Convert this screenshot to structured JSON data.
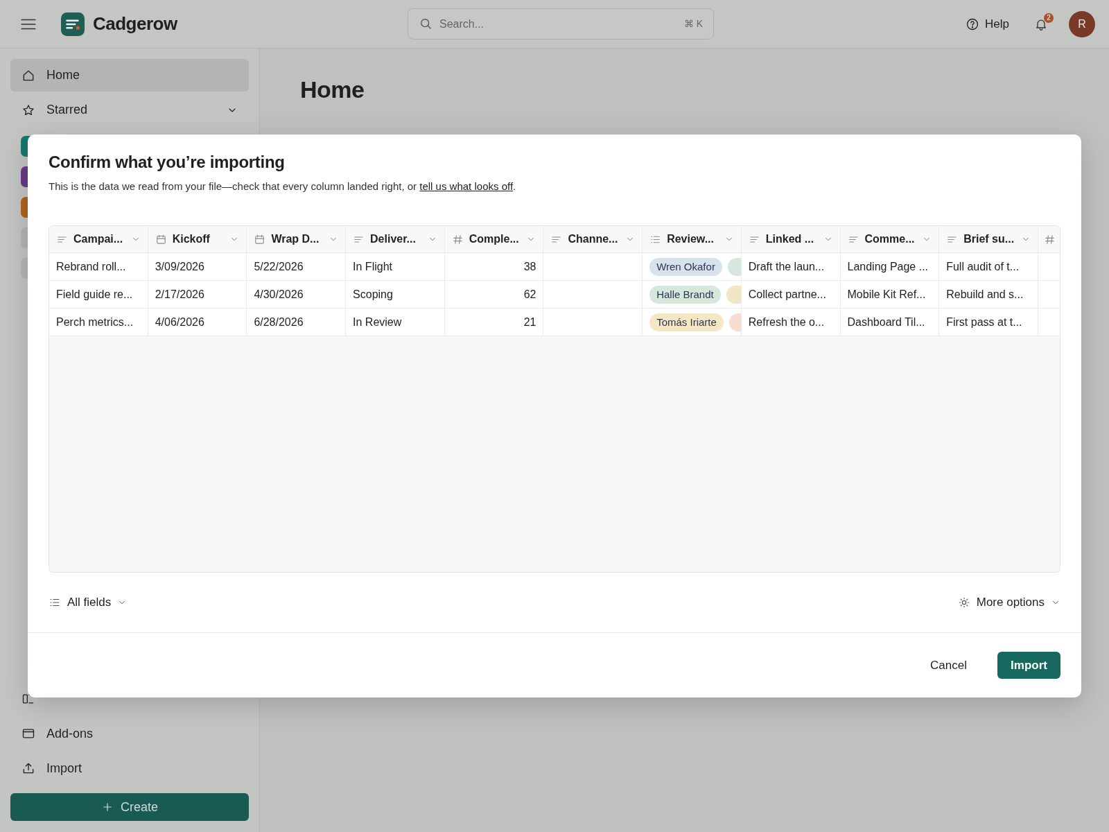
{
  "topbar": {
    "app_name": "Cadgerow",
    "search": {
      "placeholder": "Search...",
      "shortcut": "⌘ K"
    },
    "help": "Help",
    "notifications": "2",
    "avatar": "R"
  },
  "sidebar": {
    "items": [
      {
        "label": "Home",
        "selected": true
      },
      {
        "label": "Starred",
        "selected": false,
        "expandable": true
      }
    ],
    "workspaces": [
      {
        "color": "#17786f"
      },
      {
        "color": "#6a3b86"
      },
      {
        "color": "#b3641c"
      },
      {
        "color": "#b4b7b6"
      },
      {
        "color": "#b4b7b6"
      }
    ],
    "bottom_items": [
      {
        "label": "Add-ons"
      },
      {
        "label": "Import"
      }
    ],
    "create_button": "Create"
  },
  "page_title": "Home",
  "dialog": {
    "title": "Confirm what you’re importing",
    "description": "This is the data we read from your file—check that every column landed right, or ",
    "link": "tell us what looks off",
    "description_end": ".",
    "table": {
      "columns": [
        {
          "label": "Campai...",
          "kind": "text"
        },
        {
          "label": "Kickoff",
          "kind": "date"
        },
        {
          "label": "Wrap D...",
          "kind": "date"
        },
        {
          "label": "Deliver...",
          "kind": "text"
        },
        {
          "label": "Comple...",
          "kind": "number"
        },
        {
          "label": "Channe...",
          "kind": "text"
        },
        {
          "label": "Review...",
          "kind": "list"
        },
        {
          "label": "Linked ...",
          "kind": "text"
        },
        {
          "label": "Comme...",
          "kind": "text"
        },
        {
          "label": "Brief su...",
          "kind": "text"
        },
        {
          "kind": "number"
        }
      ],
      "rows": [
        {
          "cells": [
            "Rebrand roll...",
            "3/09/2026",
            "5/22/2026",
            "In Flight",
            "38",
            "",
            [
              {
                "name": "Wren Okafor",
                "color": "#d7e3ec"
              },
              {
                "color": "#d6e7dd"
              }
            ],
            "Draft the laun...",
            "Landing Page ...",
            "Full audit of t...",
            ""
          ]
        },
        {
          "cells": [
            "Field guide re...",
            "2/17/2026",
            "4/30/2026",
            "Scoping",
            "62",
            "",
            [
              {
                "name": "Halle Brandt",
                "color": "#d5e8dc"
              },
              {
                "color": "#f1e6c6"
              }
            ],
            "Collect partne...",
            "Mobile Kit Ref...",
            "Rebuild and s...",
            ""
          ]
        },
        {
          "cells": [
            "Perch metrics...",
            "4/06/2026",
            "6/28/2026",
            "In Review",
            "21",
            "",
            [
              {
                "name": "Tomás Iriarte",
                "color": "#f3e7c4"
              },
              {
                "color": "#f5ddd2"
              }
            ],
            "Refresh the o...",
            "Dashboard Til...",
            "First pass at t...",
            ""
          ]
        }
      ]
    },
    "fields_menu": "All fields",
    "more_options": "More options",
    "cancel": "Cancel",
    "confirm": "Import"
  }
}
